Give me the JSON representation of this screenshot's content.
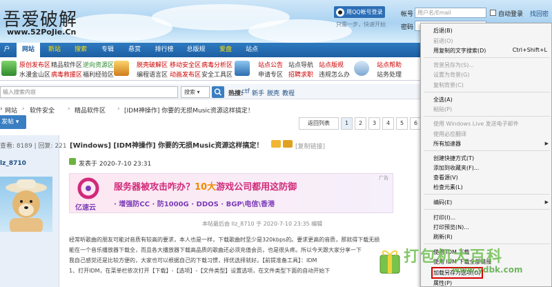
{
  "header": {
    "logo": "吾爱破解",
    "logo_sub": "www.52PoJie.Cn",
    "qq_login": "用QQ帐号登录",
    "qq_note": "只需一步，快速开始",
    "account_label": "帐号",
    "account_placeholder": "用户名/Email",
    "auto_login": "自动登录",
    "retrieve_pwd": "找回密",
    "password_label": "密码"
  },
  "nav": {
    "items": [
      "户",
      "网站",
      "新站",
      "搜索",
      "专辑",
      "悬赏",
      "排行榜",
      "总版规",
      "爱盘",
      "站点"
    ]
  },
  "sub_nav": {
    "row1": [
      "原创发布区",
      "精品软件区",
      "逆向资源区",
      "脱壳破解区",
      "移动安全区",
      "病毒分析区",
      "站点公告",
      "站点导航",
      "站点版规",
      "站点帮助"
    ],
    "row2": [
      "水漫金山区",
      "病毒救援区",
      "福利经验区",
      "编程语言区",
      "动画发布区",
      "安全工具区",
      "申请专区",
      "招聘求职",
      "违规怎么办",
      "站务处理"
    ]
  },
  "search": {
    "placeholder": "输入搜索内容",
    "scope": "搜索",
    "hot_label": "热搜:",
    "hot": [
      "ctf",
      "新手",
      "脱壳",
      "教程"
    ]
  },
  "breadcrumb": [
    "网站",
    "软件安全",
    "精品软件区",
    "[IDM神操作] 你要的无损Music资源这样搞定！"
  ],
  "toolbar": {
    "tools": "发帖",
    "back_list": "返回列表",
    "pages": [
      "1",
      "2",
      "3",
      "4",
      "5",
      "6"
    ]
  },
  "sidebar": {
    "stats": "查看: 8189 | 回复: 221",
    "username": "lz_8710"
  },
  "post": {
    "category": "[Windows]",
    "title": "[IDM神操作] 你要的无损Music资源这样搞定！",
    "copy_link": "[复制链接]",
    "posted_at": "发表于 2020-7-10 23:31",
    "edit_note": "本帖最后由 llz_8710 于 2020-7-10 23:35 编辑",
    "line1": "经常听歌曲的朋友可能对音质有较高的要求，本人也是一样，下载歌曲时至少是320kbps的。要求更高的音质，那就得下载无损",
    "line2": "能在一个音乐播放器下载全，而且各大播放器下载高品质的歌曲还必须充值会员，也是很头疼。所以今天跟大家分享一下",
    "line3": "我自己感觉还是比较方便的，大家也可以根据自己的下载习惯，择优选择就好。【前提准备工具】：IDM",
    "line4": "1、打开IDM，在菜单栏依次打开【下载】-【选项】-【文件类型】设置选项，在文件类型下面的自动开始下"
  },
  "ad": {
    "brand": "亿速云",
    "headline": "服务器被攻击咋办？",
    "highlight": "10大",
    "headline2": "游戏公司都用这防御",
    "features": "· 增强防CC  · 防1000G  · DDOS  · BGP\\电信\\香港",
    "tag": "广告"
  },
  "context_menu": {
    "items": [
      {
        "label": "后退(B)",
        "disabled": false
      },
      {
        "label": "前进(O)",
        "disabled": true
      },
      {
        "label": "用复制的文字搜索(D)",
        "disabled": false,
        "shortcut": "Ctrl+Shift+L"
      },
      {
        "label": "背景另存为(S)...",
        "disabled": true
      },
      {
        "label": "设置为背景(G)",
        "disabled": true
      },
      {
        "label": "复制背景(C)",
        "disabled": true
      },
      {
        "label": "全选(A)",
        "disabled": false
      },
      {
        "label": "粘贴(P)",
        "disabled": true
      },
      {
        "label": "使用 Windows Live 发送电子邮件",
        "disabled": true
      },
      {
        "label": "使用必应翻译",
        "disabled": true
      },
      {
        "label": "所有加速器",
        "disabled": false,
        "submenu": true
      },
      {
        "label": "创建快捷方式(T)",
        "disabled": false
      },
      {
        "label": "添加到收藏夹(F)...",
        "disabled": false
      },
      {
        "label": "查看源(V)",
        "disabled": false
      },
      {
        "label": "检查元素(L)",
        "disabled": false
      },
      {
        "label": "编码(E)",
        "disabled": false,
        "submenu": true
      },
      {
        "label": "打印(I)...",
        "disabled": false
      },
      {
        "label": "打印预览(N)...",
        "disabled": false
      },
      {
        "label": "刷新(R)",
        "disabled": false
      },
      {
        "label": "使用 IDM 下载",
        "disabled": false
      },
      {
        "label": "使用 IDM 下载全部链接",
        "disabled": false
      },
      {
        "label": "加载另存为选项(O)",
        "disabled": false
      },
      {
        "label": "属性(P)",
        "disabled": false
      }
    ]
  },
  "watermark": {
    "text": "打包机大百科",
    "url": "www.ydbk.com"
  },
  "colors": {
    "nav": "#1d5fa3",
    "accent": "#2d6fb6",
    "red": "#cc0000",
    "green": "#2a8a2a"
  }
}
